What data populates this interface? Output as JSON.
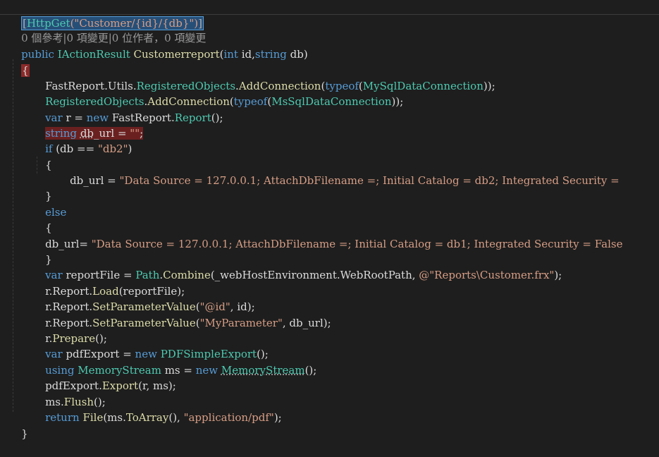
{
  "codelens": "0 個參考|0 項變更|0 位作者，0 項變更",
  "attr": {
    "open": "[",
    "name": "HttpGet",
    "args": "(\"Customer/{id}/{db}\")",
    "close": "]"
  },
  "sig": {
    "kw_public": "public",
    "ty_result": "IActionResult",
    "name": "Customerreport",
    "p1": "(",
    "kw_int": "int",
    "id": " id,",
    "kw_string": "string",
    "db": " db)"
  },
  "braces": {
    "open": "{",
    "close": "}"
  },
  "l4": {
    "a": "FastReport.Utils.",
    "b": "RegisteredObjects",
    "c": ".",
    "d": "AddConnection",
    "e": "(",
    "f": "typeof",
    "g": "(",
    "h": "MySqlDataConnection",
    "i": "));"
  },
  "l5": {
    "b": "RegisteredObjects",
    "c": ".",
    "d": "AddConnection",
    "e": "(",
    "f": "typeof",
    "g": "(",
    "h": "MsSqlDataConnection",
    "i": "));"
  },
  "l6": {
    "kw_var": "var",
    "a": " r = ",
    "kw_new": "new",
    "b": " FastReport.",
    "ty": "Report",
    "c": "();"
  },
  "l7": {
    "kw": "string",
    "a": " ",
    "db": "db",
    "u": "_url",
    "b": " = ",
    "s": "\"\"",
    "c": ";"
  },
  "l8": {
    "kw": "if",
    "a": " (db == ",
    "s": "\"db2\"",
    "b": ")"
  },
  "l10": {
    "a": "db_url = ",
    "s": "\"Data Source = 127.0.0.1; AttachDbFilename =; Initial Catalog = db2; Integrated Security = "
  },
  "l12": {
    "kw": "else"
  },
  "l14": {
    "a": "db_url= ",
    "s": "\"Data Source = 127.0.0.1; AttachDbFilename =; Initial Catalog = db1; Integrated Security = False"
  },
  "l16": {
    "kw": "var",
    "a": " reportFile = ",
    "ty": "Path",
    "b": ".",
    "fn": "Combine",
    "c": "(_webHostEnvironment.WebRootPath, ",
    "s": "@\"Reports\\Customer.frx\"",
    "d": ");"
  },
  "l17": {
    "a": "r.Report.",
    "fn": "Load",
    "b": "(reportFile);"
  },
  "l18": {
    "a": "r.Report.",
    "fn": "SetParameterValue",
    "b": "(",
    "s": "\"@id\"",
    "c": ", id);"
  },
  "l19": {
    "a": "r.Report.",
    "fn": "SetParameterValue",
    "b": "(",
    "s": "\"MyParameter\"",
    "c": ", db_url);"
  },
  "l20": {
    "a": "r.",
    "fn": "Prepare",
    "b": "();"
  },
  "l21": {
    "kw": "var",
    "a": " pdfExport = ",
    "kw_new": "new",
    "b": " ",
    "ty": "PDFSimpleExport",
    "c": "();"
  },
  "l22": {
    "kw": "using",
    "a": " ",
    "ty": "MemoryStream",
    "b": " ms = ",
    "kw_new": "new",
    "c": " ",
    "ty2": "MemoryStream",
    "d": "();"
  },
  "l23": {
    "a": "pdfExport.",
    "fn": "Export",
    "b": "(r, ms);"
  },
  "l24": {
    "a": "ms.",
    "fn": "Flush",
    "b": "();"
  },
  "l25": {
    "kw": "return",
    "a": " ",
    "fn": "File",
    "b": "(ms.",
    "fn2": "ToArray",
    "c": "(), ",
    "s": "\"application/pdf\"",
    "d": ");"
  }
}
